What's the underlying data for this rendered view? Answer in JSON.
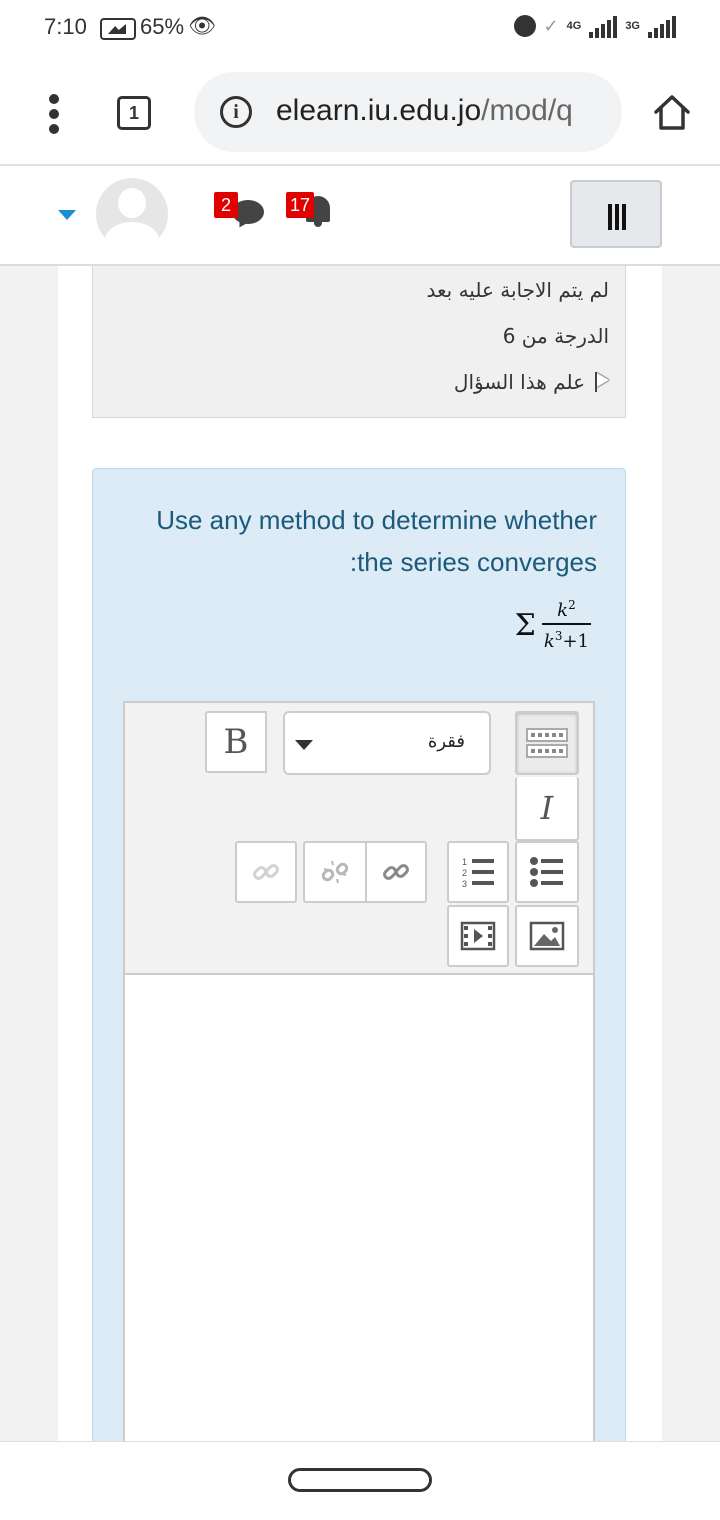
{
  "status_bar": {
    "time": "7:10",
    "battery": "65%",
    "network_1": "4G",
    "network_2": "3G"
  },
  "browser": {
    "tab_count": "1",
    "url_domain": "elearn.iu.edu.jo",
    "url_path": "/mod/q"
  },
  "navbar": {
    "messages_count": "2",
    "notifications_count": "17",
    "accent_color": "#1a8fd6",
    "badge_color": "#e10000"
  },
  "question_info": {
    "state": "لم يتم الاجابة عليه بعد",
    "grade": "الدرجة من 6",
    "flag_label": "علم هذا السؤال"
  },
  "question": {
    "text_line1": "Use any method to determine whether",
    "text_line2": ":the series converges",
    "formula": {
      "sigma": "Σ",
      "numerator_var": "k",
      "numerator_exp": "2",
      "denominator_var": "k",
      "denominator_exp": "3",
      "denominator_rest": "+1"
    }
  },
  "editor": {
    "bold_label": "B",
    "italic_label": "I",
    "paragraph_select": "فقرة",
    "answer_text": ""
  },
  "icons": {
    "browser_menu": "kebab-menu-icon",
    "info": "info-icon",
    "home": "home-icon",
    "messages": "speech-bubble-icon",
    "notifications": "bell-icon",
    "hamburger": "hamburger-menu-icon",
    "flag": "flag-icon",
    "link": "link-icon",
    "unlink": "unlink-icon",
    "ordered_list": "ordered-list-icon",
    "unordered_list": "unordered-list-icon",
    "media": "media-icon",
    "image": "image-icon",
    "toolbar_expand": "toolbar-expand-icon"
  }
}
